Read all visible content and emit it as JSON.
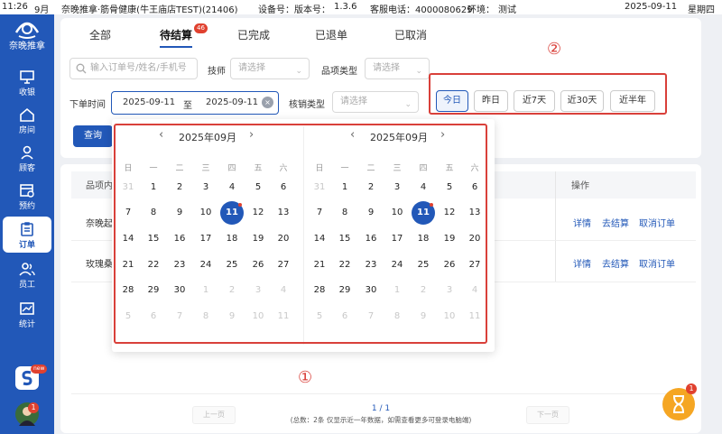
{
  "status": {
    "time": "11:26",
    "date_short": "9月",
    "title": "奈晚推拿·筋骨健康(牛王庙店TEST)(21406)",
    "device": "设备号：版本号：",
    "version": "1.3.6",
    "hotline": "客服电话：4000080629",
    "env": "环境：",
    "env_value": "测试",
    "date": "2025-09-11",
    "weekday": "星期四"
  },
  "sidebar": {
    "logo_text": "奈晚推拿",
    "items": [
      {
        "label": "收银"
      },
      {
        "label": "房间"
      },
      {
        "label": "顾客"
      },
      {
        "label": "预约"
      },
      {
        "label": "订单"
      },
      {
        "label": "员工"
      },
      {
        "label": "统计"
      }
    ],
    "new_badge": "new",
    "avatar_badge": "1"
  },
  "tabs": [
    {
      "label": "全部"
    },
    {
      "label": "待结算"
    },
    {
      "label": "已完成"
    },
    {
      "label": "已退单"
    },
    {
      "label": "已取消"
    }
  ],
  "tab_badge": "46",
  "filters": {
    "search_placeholder": "输入订单号/姓名/手机号",
    "tech_label": "技师",
    "tech_placeholder": "请选择",
    "item_type_label": "品项类型",
    "item_type_placeholder": "请选择",
    "date_label": "下单时间",
    "date_start": "2025-09-11",
    "date_sep": "至",
    "date_end": "2025-09-11",
    "verify_label": "核销类型",
    "verify_placeholder": "请选择",
    "quick": [
      "今日",
      "昨日",
      "近7天",
      "近30天",
      "近半年"
    ],
    "search_button": "查询"
  },
  "annotations": {
    "one": "①",
    "two": "②"
  },
  "table": {
    "col_item": "品项内",
    "col_ops": "操作",
    "rows": [
      {
        "item": "奈晚起"
      },
      {
        "item": "玫瑰桑"
      }
    ],
    "ops": [
      "详情",
      "去结算",
      "取消订单"
    ]
  },
  "pager": {
    "prev": "上一页",
    "next": "下一页",
    "page": "1 / 1",
    "note": "(总数：2条 仅显示近一年数据，如需查看更多可登录电脑端)"
  },
  "calendar": {
    "left_header": "2025年09月",
    "right_header": "2025年09月",
    "weekdays": [
      "日",
      "一",
      "二",
      "三",
      "四",
      "五",
      "六"
    ],
    "days": [
      "31",
      "1",
      "2",
      "3",
      "4",
      "5",
      "6",
      "7",
      "8",
      "9",
      "10",
      "11",
      "12",
      "13",
      "14",
      "15",
      "16",
      "17",
      "18",
      "19",
      "20",
      "21",
      "22",
      "23",
      "24",
      "25",
      "26",
      "27",
      "28",
      "29",
      "30",
      "1",
      "2",
      "3",
      "4",
      "5",
      "6",
      "7",
      "8",
      "9",
      "10",
      "11"
    ],
    "selected_day": "11"
  },
  "float_badge": "1",
  "colors": {
    "primary": "#2258b8",
    "annotation": "#d9403a",
    "badge": "#e0412f"
  }
}
